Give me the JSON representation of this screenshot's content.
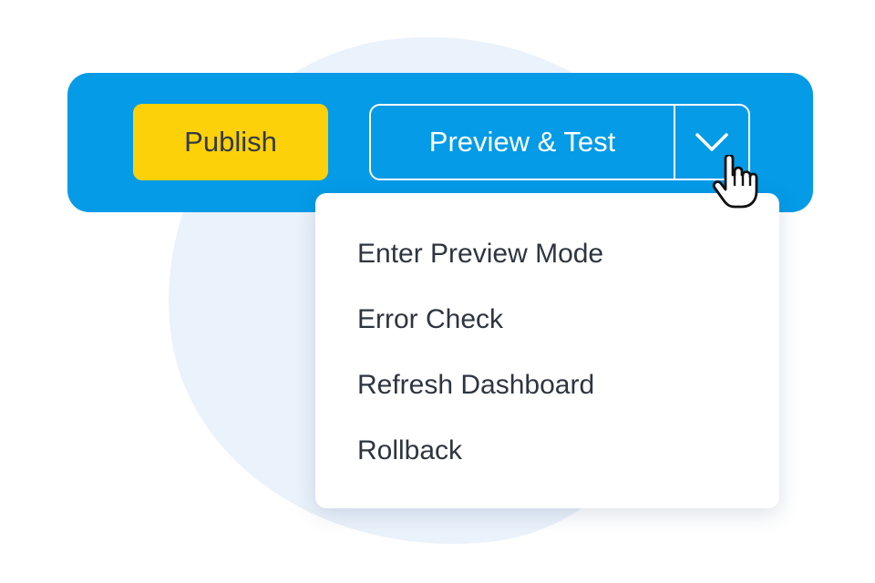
{
  "toolbar": {
    "publish_label": "Publish",
    "preview_label": "Preview & Test",
    "caret_icon": "chevron-down-icon",
    "background_color": "#059be7",
    "publish_color": "#fcd10a"
  },
  "dropdown": {
    "items": [
      {
        "label": "Enter Preview Mode"
      },
      {
        "label": "Error Check"
      },
      {
        "label": "Refresh Dashboard"
      },
      {
        "label": "Rollback"
      }
    ]
  },
  "cursor": {
    "icon": "hand-pointer-icon"
  }
}
